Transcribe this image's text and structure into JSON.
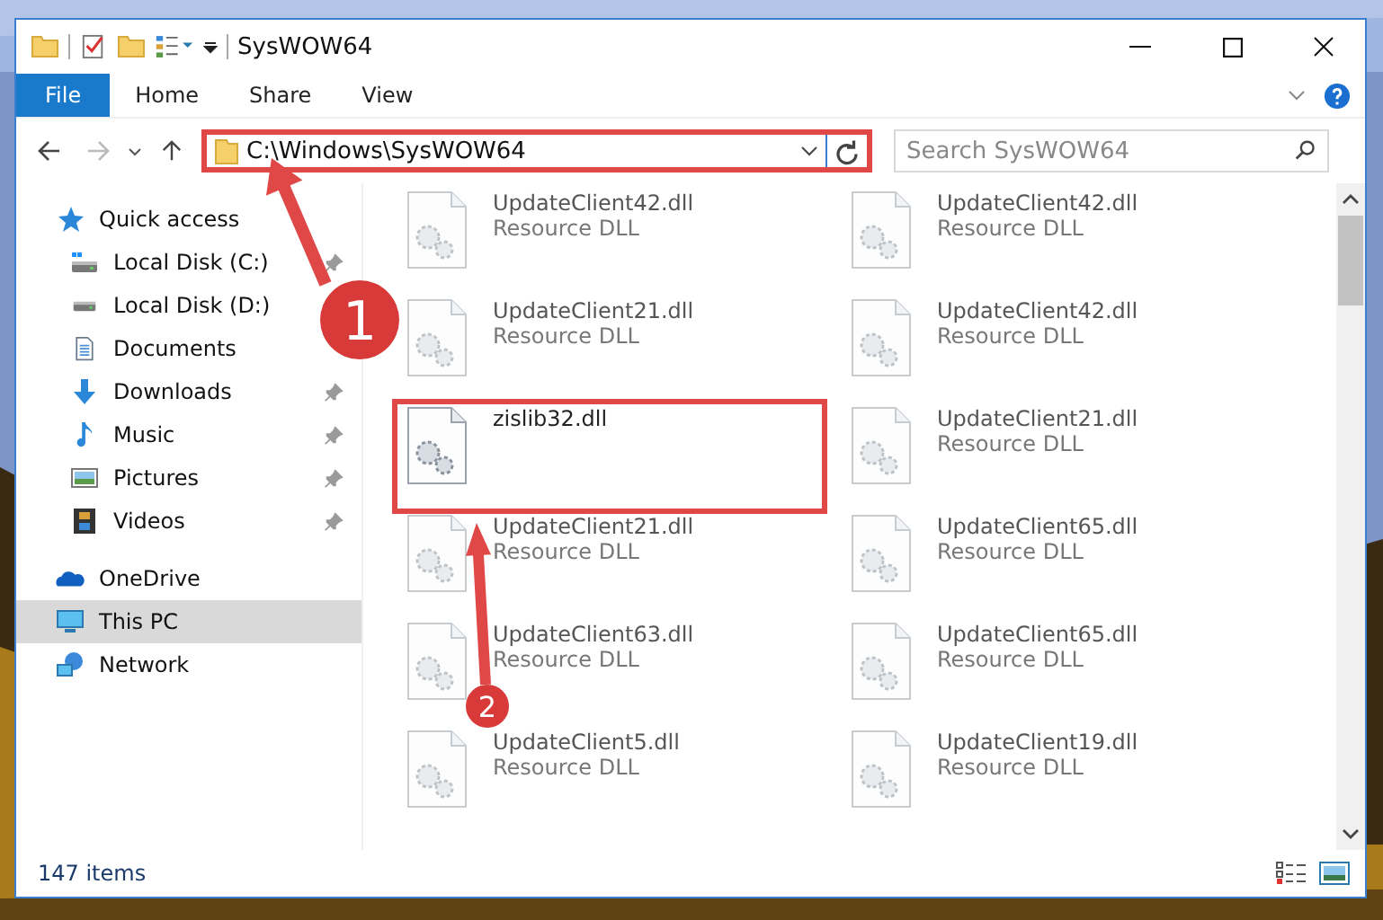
{
  "window": {
    "title": "SysWOW64"
  },
  "ribbon": {
    "tabs": [
      {
        "label": "File",
        "selected": true
      },
      {
        "label": "Home",
        "selected": false
      },
      {
        "label": "Share",
        "selected": false
      },
      {
        "label": "View",
        "selected": false
      }
    ]
  },
  "address_bar": {
    "path": "C:\\Windows\\SysWOW64",
    "highlighted": true
  },
  "search": {
    "placeholder": "Search SysWOW64"
  },
  "sidebar": {
    "items": [
      {
        "label": "Quick access",
        "kind": "star",
        "selected": false,
        "children": [
          {
            "label": "Local Disk (C:)",
            "kind": "drive-c",
            "pinned": true
          },
          {
            "label": "Local Disk (D:)",
            "kind": "drive",
            "pinned": false
          },
          {
            "label": "Documents",
            "kind": "document",
            "pinned": false
          },
          {
            "label": "Downloads",
            "kind": "download",
            "pinned": true
          },
          {
            "label": "Music",
            "kind": "music",
            "pinned": true
          },
          {
            "label": "Pictures",
            "kind": "pictures",
            "pinned": true
          },
          {
            "label": "Videos",
            "kind": "videos",
            "pinned": true
          }
        ]
      },
      {
        "label": "OneDrive",
        "kind": "cloud",
        "selected": false
      },
      {
        "label": "This PC",
        "kind": "pc",
        "selected": true
      },
      {
        "label": "Network",
        "kind": "network",
        "selected": false
      }
    ]
  },
  "files": [
    {
      "name": "UpdateClient42.dll",
      "type": "Resource DLL",
      "blurred": true,
      "highlighted": false
    },
    {
      "name": "UpdateClient42.dll",
      "type": "Resource DLL",
      "blurred": true,
      "highlighted": false
    },
    {
      "name": "UpdateClient21.dll",
      "type": "Resource DLL",
      "blurred": true,
      "highlighted": false
    },
    {
      "name": "UpdateClient42.dll",
      "type": "Resource DLL",
      "blurred": true,
      "highlighted": false
    },
    {
      "name": "zislib32.dll",
      "blurred": false,
      "highlighted": true
    },
    {
      "name": "UpdateClient21.dll",
      "type": "Resource DLL",
      "blurred": true,
      "highlighted": false
    },
    {
      "name": "UpdateClient21.dll",
      "type": "Resource DLL",
      "blurred": true,
      "highlighted": false
    },
    {
      "name": "UpdateClient65.dll",
      "type": "Resource DLL",
      "blurred": true,
      "highlighted": false
    },
    {
      "name": "UpdateClient63.dll",
      "type": "Resource DLL",
      "blurred": true,
      "highlighted": false
    },
    {
      "name": "UpdateClient65.dll",
      "type": "Resource DLL",
      "blurred": true,
      "highlighted": false
    },
    {
      "name": "UpdateClient5.dll",
      "type": "Resource DLL",
      "blurred": true,
      "highlighted": false
    },
    {
      "name": "UpdateClient19.dll",
      "type": "Resource DLL",
      "blurred": true,
      "highlighted": false
    }
  ],
  "status_bar": {
    "item_count": "147 items"
  },
  "annotations": [
    {
      "number": "1"
    },
    {
      "number": "2"
    }
  ]
}
